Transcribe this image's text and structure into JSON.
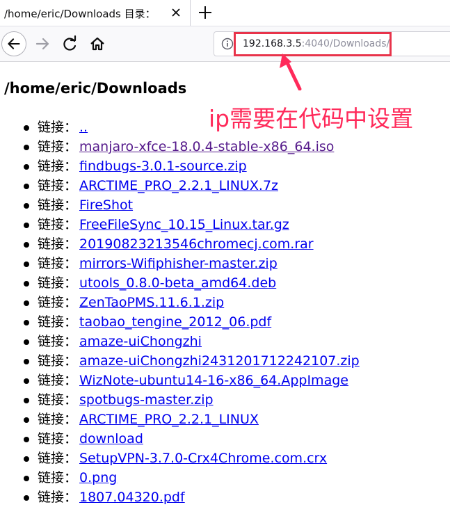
{
  "tab": {
    "title": "/home/eric/Downloads 目录："
  },
  "toolbar": {
    "url_host": "192.168.3.5",
    "url_rest": ":4040/Downloads/"
  },
  "annotation": {
    "text": "ip需要在代码中设置",
    "color": "#ff2a5a"
  },
  "page": {
    "heading": "/home/eric/Downloads",
    "prefix": "链接：",
    "items": [
      {
        "label": "..",
        "visited": false
      },
      {
        "label": "manjaro-xfce-18.0.4-stable-x86_64.iso",
        "visited": true
      },
      {
        "label": "findbugs-3.0.1-source.zip",
        "visited": false
      },
      {
        "label": "ARCTIME_PRO_2.2.1_LINUX.7z",
        "visited": false
      },
      {
        "label": "FireShot",
        "visited": false
      },
      {
        "label": "FreeFileSync_10.15_Linux.tar.gz",
        "visited": false
      },
      {
        "label": "20190823213546chromecj.com.rar",
        "visited": false
      },
      {
        "label": "mirrors-Wifiphisher-master.zip",
        "visited": false
      },
      {
        "label": "utools_0.8.0-beta_amd64.deb",
        "visited": false
      },
      {
        "label": "ZenTaoPMS.11.6.1.zip",
        "visited": false
      },
      {
        "label": "taobao_tengine_2012_06.pdf",
        "visited": false
      },
      {
        "label": "amaze-uiChongzhi",
        "visited": false
      },
      {
        "label": "amaze-uiChongzhi2431201712242107.zip",
        "visited": false
      },
      {
        "label": "WizNote-ubuntu14-16-x86_64.AppImage",
        "visited": false
      },
      {
        "label": "spotbugs-master.zip",
        "visited": false
      },
      {
        "label": "ARCTIME_PRO_2.2.1_LINUX",
        "visited": false
      },
      {
        "label": "download",
        "visited": false
      },
      {
        "label": "SetupVPN-3.7.0-Crx4Chrome.com.crx",
        "visited": false
      },
      {
        "label": "0.png",
        "visited": false
      },
      {
        "label": "1807.04320.pdf",
        "visited": false
      }
    ]
  },
  "colors": {
    "link": "#0000ee",
    "visited_link": "#551a8b",
    "highlight": "#e8334a"
  }
}
